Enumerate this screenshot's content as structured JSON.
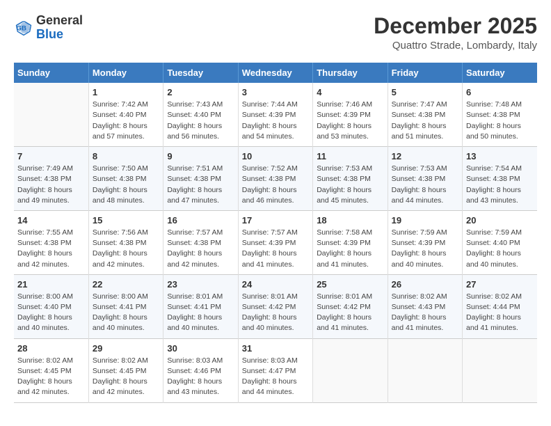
{
  "header": {
    "logo_general": "General",
    "logo_blue": "Blue",
    "title": "December 2025",
    "subtitle": "Quattro Strade, Lombardy, Italy"
  },
  "weekdays": [
    "Sunday",
    "Monday",
    "Tuesday",
    "Wednesday",
    "Thursday",
    "Friday",
    "Saturday"
  ],
  "weeks": [
    {
      "days": [
        {
          "num": "",
          "info": ""
        },
        {
          "num": "1",
          "info": "Sunrise: 7:42 AM\nSunset: 4:40 PM\nDaylight: 8 hours\nand 57 minutes."
        },
        {
          "num": "2",
          "info": "Sunrise: 7:43 AM\nSunset: 4:40 PM\nDaylight: 8 hours\nand 56 minutes."
        },
        {
          "num": "3",
          "info": "Sunrise: 7:44 AM\nSunset: 4:39 PM\nDaylight: 8 hours\nand 54 minutes."
        },
        {
          "num": "4",
          "info": "Sunrise: 7:46 AM\nSunset: 4:39 PM\nDaylight: 8 hours\nand 53 minutes."
        },
        {
          "num": "5",
          "info": "Sunrise: 7:47 AM\nSunset: 4:38 PM\nDaylight: 8 hours\nand 51 minutes."
        },
        {
          "num": "6",
          "info": "Sunrise: 7:48 AM\nSunset: 4:38 PM\nDaylight: 8 hours\nand 50 minutes."
        }
      ]
    },
    {
      "days": [
        {
          "num": "7",
          "info": "Sunrise: 7:49 AM\nSunset: 4:38 PM\nDaylight: 8 hours\nand 49 minutes."
        },
        {
          "num": "8",
          "info": "Sunrise: 7:50 AM\nSunset: 4:38 PM\nDaylight: 8 hours\nand 48 minutes."
        },
        {
          "num": "9",
          "info": "Sunrise: 7:51 AM\nSunset: 4:38 PM\nDaylight: 8 hours\nand 47 minutes."
        },
        {
          "num": "10",
          "info": "Sunrise: 7:52 AM\nSunset: 4:38 PM\nDaylight: 8 hours\nand 46 minutes."
        },
        {
          "num": "11",
          "info": "Sunrise: 7:53 AM\nSunset: 4:38 PM\nDaylight: 8 hours\nand 45 minutes."
        },
        {
          "num": "12",
          "info": "Sunrise: 7:53 AM\nSunset: 4:38 PM\nDaylight: 8 hours\nand 44 minutes."
        },
        {
          "num": "13",
          "info": "Sunrise: 7:54 AM\nSunset: 4:38 PM\nDaylight: 8 hours\nand 43 minutes."
        }
      ]
    },
    {
      "days": [
        {
          "num": "14",
          "info": "Sunrise: 7:55 AM\nSunset: 4:38 PM\nDaylight: 8 hours\nand 42 minutes."
        },
        {
          "num": "15",
          "info": "Sunrise: 7:56 AM\nSunset: 4:38 PM\nDaylight: 8 hours\nand 42 minutes."
        },
        {
          "num": "16",
          "info": "Sunrise: 7:57 AM\nSunset: 4:38 PM\nDaylight: 8 hours\nand 42 minutes."
        },
        {
          "num": "17",
          "info": "Sunrise: 7:57 AM\nSunset: 4:39 PM\nDaylight: 8 hours\nand 41 minutes."
        },
        {
          "num": "18",
          "info": "Sunrise: 7:58 AM\nSunset: 4:39 PM\nDaylight: 8 hours\nand 41 minutes."
        },
        {
          "num": "19",
          "info": "Sunrise: 7:59 AM\nSunset: 4:39 PM\nDaylight: 8 hours\nand 40 minutes."
        },
        {
          "num": "20",
          "info": "Sunrise: 7:59 AM\nSunset: 4:40 PM\nDaylight: 8 hours\nand 40 minutes."
        }
      ]
    },
    {
      "days": [
        {
          "num": "21",
          "info": "Sunrise: 8:00 AM\nSunset: 4:40 PM\nDaylight: 8 hours\nand 40 minutes."
        },
        {
          "num": "22",
          "info": "Sunrise: 8:00 AM\nSunset: 4:41 PM\nDaylight: 8 hours\nand 40 minutes."
        },
        {
          "num": "23",
          "info": "Sunrise: 8:01 AM\nSunset: 4:41 PM\nDaylight: 8 hours\nand 40 minutes."
        },
        {
          "num": "24",
          "info": "Sunrise: 8:01 AM\nSunset: 4:42 PM\nDaylight: 8 hours\nand 40 minutes."
        },
        {
          "num": "25",
          "info": "Sunrise: 8:01 AM\nSunset: 4:42 PM\nDaylight: 8 hours\nand 41 minutes."
        },
        {
          "num": "26",
          "info": "Sunrise: 8:02 AM\nSunset: 4:43 PM\nDaylight: 8 hours\nand 41 minutes."
        },
        {
          "num": "27",
          "info": "Sunrise: 8:02 AM\nSunset: 4:44 PM\nDaylight: 8 hours\nand 41 minutes."
        }
      ]
    },
    {
      "days": [
        {
          "num": "28",
          "info": "Sunrise: 8:02 AM\nSunset: 4:45 PM\nDaylight: 8 hours\nand 42 minutes."
        },
        {
          "num": "29",
          "info": "Sunrise: 8:02 AM\nSunset: 4:45 PM\nDaylight: 8 hours\nand 42 minutes."
        },
        {
          "num": "30",
          "info": "Sunrise: 8:03 AM\nSunset: 4:46 PM\nDaylight: 8 hours\nand 43 minutes."
        },
        {
          "num": "31",
          "info": "Sunrise: 8:03 AM\nSunset: 4:47 PM\nDaylight: 8 hours\nand 44 minutes."
        },
        {
          "num": "",
          "info": ""
        },
        {
          "num": "",
          "info": ""
        },
        {
          "num": "",
          "info": ""
        }
      ]
    }
  ]
}
